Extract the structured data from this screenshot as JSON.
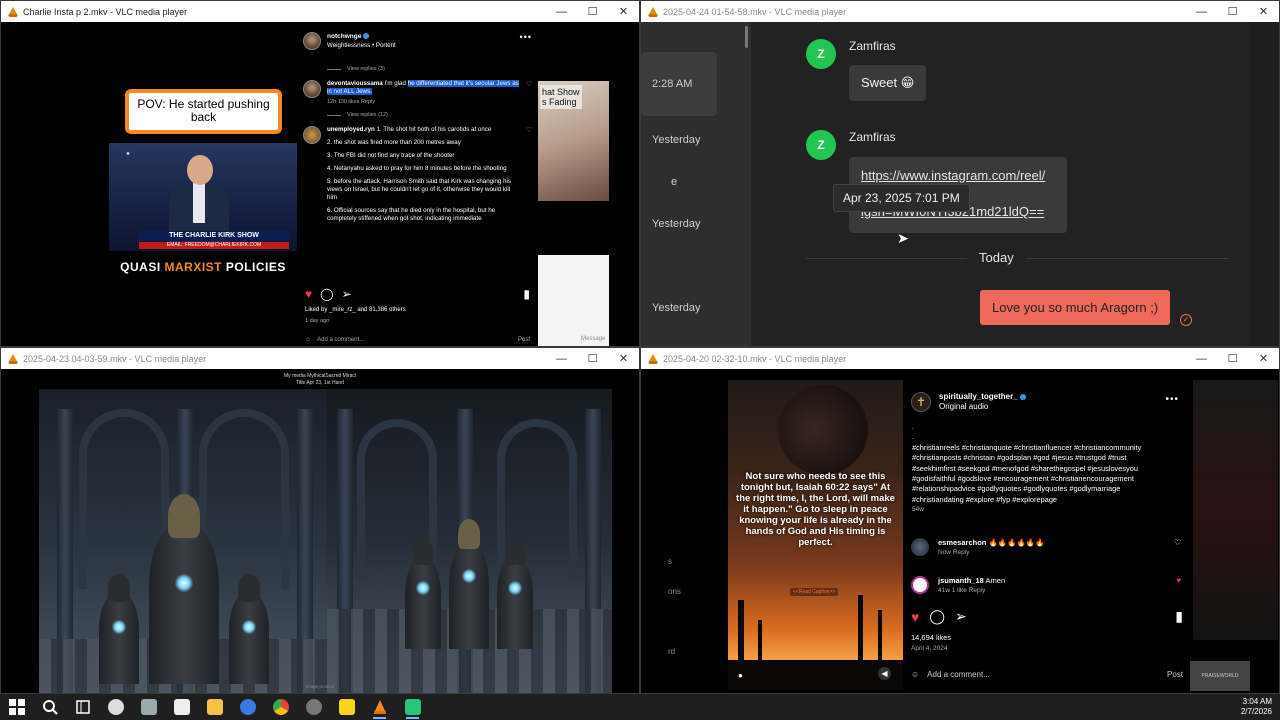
{
  "windows": {
    "w1": {
      "title": "Charlie Insta p 2.mkv - VLC media player",
      "pov": "POV: He started pushing back",
      "tv_banner": "THE CHARLIE KIRK SHOW",
      "tv_url": "EMAIL: FREEDOM@CHARLIEKIRK.COM",
      "caption_a": "QUASI ",
      "caption_b": "MARXIST",
      "caption_c": " POLICIES",
      "ig": {
        "username": "notchwnge",
        "subtitle": "Weightlessness • Portent",
        "view_replies_1": "View replies (3)",
        "c1_user": "devontavioussama",
        "c1_pre": " I'm glad ",
        "c1_sel": "he differentiated that it's secular Jews as in not ALL Jews.",
        "c1_meta": "12h   130 likes   Reply",
        "view_replies_2": "View replies (12)",
        "c2_user": "unemployed.ryn",
        "c2_lines": [
          "1. The shot hit both of his carotids at once",
          "2. the shot was fired more than 200 metres away",
          "3. The FBI did not find any trace of the shooter",
          "4. Netanyahu asked to pray for him 8 minutes before the shooting",
          "5. before the attack, Harrison Smith said that Kirk was changing his views on Israel, but he couldn't let go of it, otherwise they would kill him",
          "6. Official sources say that he died only in the hospital, but he completely stiffened when got shot, indicating immediate"
        ],
        "liked_by": "Liked by _mire_rz_ and 81,386 others",
        "day": "1 day ago",
        "add_comment": "Add a comment...",
        "post": "Post"
      },
      "side_text": "hat Show\ns Fading",
      "side_msg": "Message"
    },
    "w2": {
      "title": "2025-04-24 01-54-58.mkv - VLC media player",
      "side_labels": [
        "2:28 AM",
        "Yesterday",
        "e",
        "Yesterday",
        "Yesterday"
      ],
      "sender": "Zamfiras",
      "avatar_letter": "Z",
      "msg1": "Sweet 😁",
      "link1": "https://www.instagram.com/reel/",
      "link2": "igsh=MWI0NTI3b21md21ldQ==",
      "tooltip": "Apr 23, 2025 7:01 PM",
      "today": "Today",
      "mine": "Love you so much Aragorn ;)"
    },
    "w3": {
      "title": "2025-04-23 04-03-59.mkv - VLC media player",
      "top_a": "My media     MythicalSacred Miracl",
      "top_b": "Title   Apr 23, 1st Hand",
      "bottom": "Image product"
    },
    "w4": {
      "title": "2025-04-20 02-32-10.mkv - VLC media player",
      "left_labels": [
        "s",
        "ons",
        "rd"
      ],
      "quote": "Not sure who needs to see this tonight but, Isaiah 60:22 says\" At the right time, I, the Lord, will make it happen.\" Go to sleep in peace knowing your life is already in the hands of God and His timing is perfect.",
      "read_caption": "<<Read Caption>>",
      "username": "spiritually_together_",
      "audio": "Original audio",
      "hashtags": ".\n.\n#christianreels #christianquote #christianfluencer #christiancommunity #christianposts #christain #godsplan #god #jesus #trustgod #trust #seekhimfirst #seekgod #menofgod #sharethegospel #jesuslovesyou #godisfaithful #godslove #encouragement #christianencouragement #relationshipadvice #godlyquotes #godlyquotes #godlymarriage #christiandating #explore #fyp #explorepage",
      "tags_age": "54w",
      "c1_user": "esmesarchon",
      "c1_text": "🔥🔥🔥🔥🔥🔥",
      "c1_meta": "Now   Reply",
      "c2_user": "jsumanth_18",
      "c2_text": "Amen",
      "c2_meta": "41w   1 like   Reply",
      "likes": "14,694 likes",
      "date": "April 4, 2024",
      "add_comment": "Add a comment...",
      "post": "Post",
      "praise": "PRAISEWORLD"
    }
  },
  "taskbar": {
    "time": "3:04 AM",
    "date": "2/7/2026",
    "apps": [
      "start",
      "search",
      "task-view",
      "clock-app",
      "app-gray",
      "app-white",
      "file-explorer",
      "app-blue-bird",
      "chrome",
      "app-globe",
      "sticky-notes",
      "vlc",
      "app-green"
    ]
  },
  "colors": {
    "accent_orange": "#f28a1e",
    "chat_green": "#23c552",
    "my_bubble": "#f06a5c",
    "ig_blue_select": "#1a5bd0",
    "heart_red": "#ed3a4f"
  }
}
